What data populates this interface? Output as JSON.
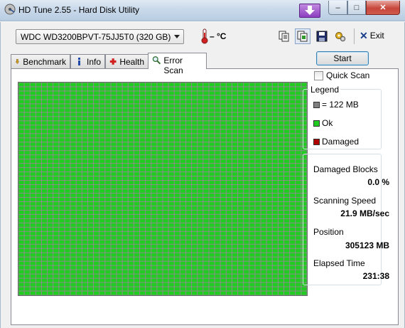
{
  "window": {
    "title": "HD Tune 2.55 - Hard Disk Utility",
    "minimize_glyph": "–",
    "maximize_glyph": "□",
    "close_glyph": "✕"
  },
  "toolbar": {
    "drive": "WDC WD3200BPVT-75JJ5T0 (320 GB)",
    "temperature": "– °C",
    "exit_label": "Exit",
    "icons": [
      "copy-info-icon",
      "copy-screenshot-icon",
      "save-icon",
      "options-icon",
      "exit-icon"
    ]
  },
  "tabs": [
    {
      "label": "Benchmark",
      "icon": "benchmark-icon"
    },
    {
      "label": "Info",
      "icon": "info-icon"
    },
    {
      "label": "Health",
      "icon": "health-cross-icon"
    },
    {
      "label": "Error Scan",
      "icon": "magnifier-icon",
      "active": true
    }
  ],
  "error_scan": {
    "start_label": "Start",
    "quick_scan_label": "Quick Scan",
    "quick_scan_checked": false,
    "legend": {
      "title": "Legend",
      "block_size": "= 122 MB",
      "ok": "Ok",
      "damaged": "Damaged"
    },
    "stats": {
      "damaged_blocks_label": "Damaged Blocks",
      "damaged_blocks_value": "0.0 %",
      "scanning_speed_label": "Scanning Speed",
      "scanning_speed_value": "21.9 MB/sec",
      "position_label": "Position",
      "position_value": "305123 MB",
      "elapsed_time_label": "Elapsed Time",
      "elapsed_time_value": "231:38"
    },
    "grid": {
      "columns": 50,
      "rows": 50,
      "ok_fraction": 1.0,
      "ok_color": "#21cc21",
      "damaged_color": "#cc0000",
      "unscanned_color": "#8c8c8c"
    }
  },
  "colors": {
    "accent": "#3c7fb1",
    "ok_green": "#21cc21",
    "damaged_red": "#b00000",
    "neutral_gray": "#808080"
  }
}
